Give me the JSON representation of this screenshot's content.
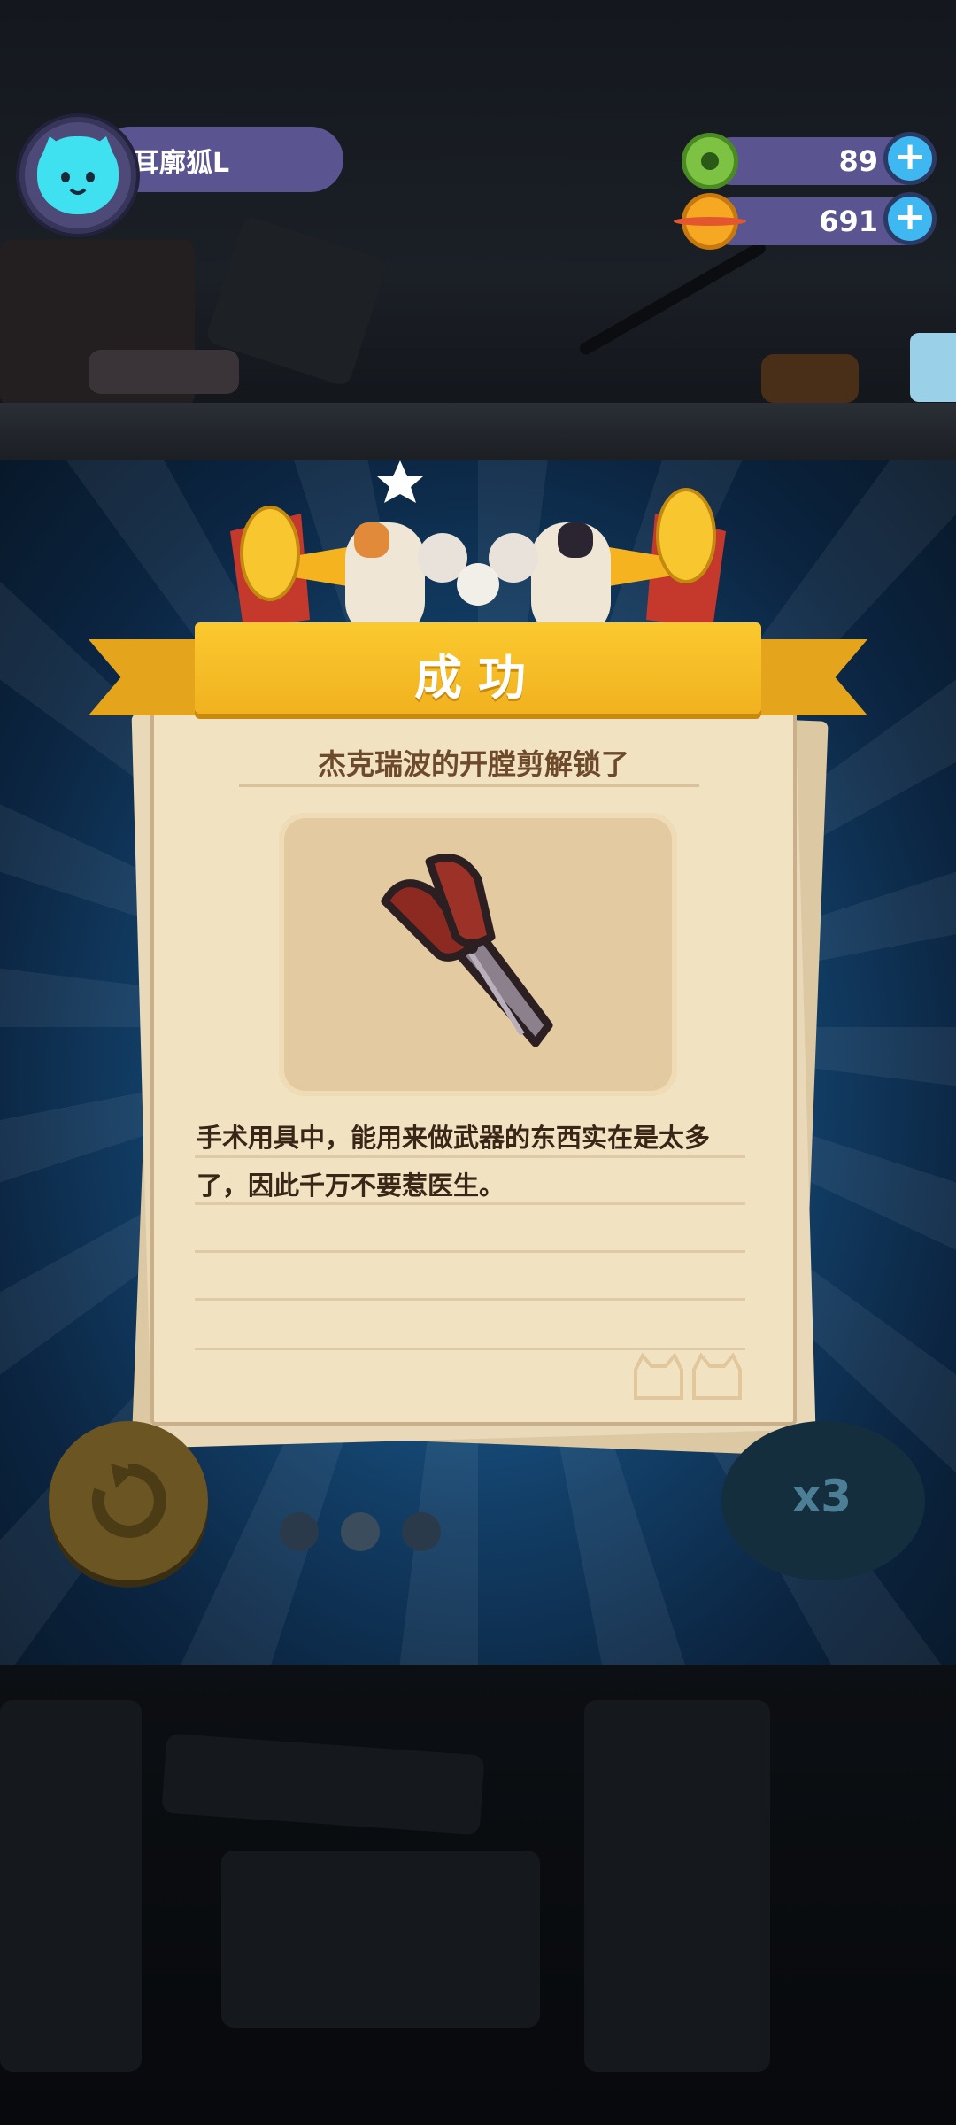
{
  "hud": {
    "player_name": "耳廓狐L",
    "currencies": [
      {
        "icon": "donut-icon",
        "value": "89",
        "color": "#7dc243"
      },
      {
        "icon": "planet-coin-icon",
        "value": "691",
        "color": "#f6a822"
      }
    ],
    "plus_symbol": "+"
  },
  "card": {
    "banner_title": "成功",
    "heading": "杰克瑞波的开膛剪解锁了",
    "item_icon": "scissors-icon",
    "description": "手术用具中，能用来做武器的东西实在是太多了，因此千万不要惹医生。"
  },
  "controls": {
    "retry_icon": "retry-icon",
    "speed_label": "x3"
  },
  "colors": {
    "ribbon": "#f1b21f",
    "paper": "#f1e3c2",
    "pill": "#5a5490",
    "accent_blue": "#3fb7f0"
  }
}
